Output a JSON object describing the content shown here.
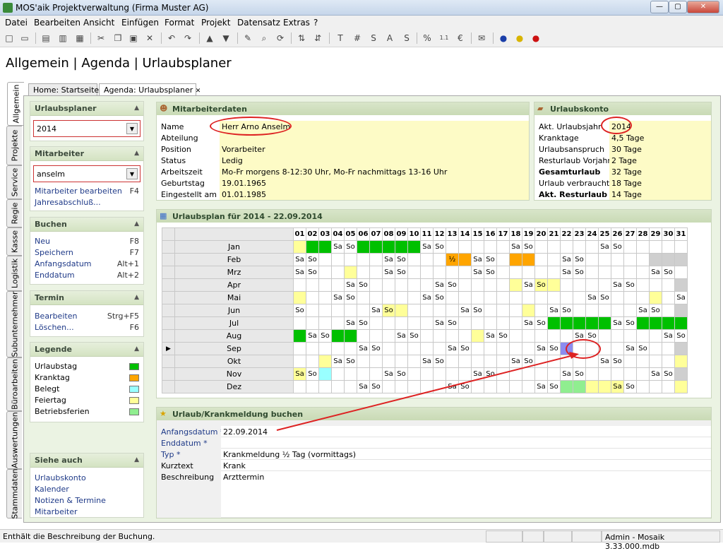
{
  "window": {
    "title": "MOS'aik Projektverwaltung (Firma Muster AG)",
    "minimize": "—",
    "maximize": "▢",
    "close": "✕"
  },
  "menu": [
    "Datei",
    "Bearbeiten",
    "Ansicht",
    "Einfügen",
    "Format",
    "Projekt",
    "Datensatz",
    "Extras",
    "?"
  ],
  "page_title": "Allgemein | Agenda | Urlaubsplaner",
  "vtabs": [
    "Allgemein",
    "Projekte",
    "Service",
    "Regie",
    "Kasse",
    "Logistik",
    "Subunternehmer",
    "Büroarbeiten",
    "Auswertungen",
    "Stammdaten"
  ],
  "doc_tabs": [
    "Home: Startseite",
    "Agenda: Urlaubsplaner"
  ],
  "sidebar": {
    "urlaubsplaner": {
      "title": "Urlaubsplaner",
      "value": "2014"
    },
    "mitarbeiter": {
      "title": "Mitarbeiter",
      "value": "anselm",
      "items": [
        {
          "label": "Mitarbeiter bearbeiten",
          "key": "F4"
        },
        {
          "label": "Jahresabschluß...",
          "key": ""
        }
      ]
    },
    "buchen": {
      "title": "Buchen",
      "items": [
        {
          "label": "Neu",
          "key": "F8"
        },
        {
          "label": "Speichern",
          "key": "F7"
        },
        {
          "label": "Anfangsdatum",
          "key": "Alt+1"
        },
        {
          "label": "Enddatum",
          "key": "Alt+2"
        }
      ]
    },
    "termin": {
      "title": "Termin",
      "items": [
        {
          "label": "Bearbeiten",
          "key": "Strg+F5"
        },
        {
          "label": "Löschen...",
          "key": "F6"
        }
      ]
    },
    "legende": {
      "title": "Legende",
      "items": [
        {
          "label": "Urlaubstag",
          "color": "#00c000"
        },
        {
          "label": "Kranktag",
          "color": "#ffa500"
        },
        {
          "label": "Belegt",
          "color": "#99ffff"
        },
        {
          "label": "Feiertag",
          "color": "#ffff99"
        },
        {
          "label": "Betriebsferien",
          "color": "#90ee90"
        }
      ]
    },
    "siehe_auch": {
      "title": "Siehe auch",
      "items": [
        "Urlaubskonto",
        "Kalender",
        "Notizen & Termine",
        "Mitarbeiter"
      ]
    }
  },
  "mitarbeiterdaten": {
    "title": "Mitarbeiterdaten",
    "rows": [
      {
        "label": "Name",
        "value": "Herr Arno Anselm"
      },
      {
        "label": "Abteilung",
        "value": ""
      },
      {
        "label": "Position",
        "value": "Vorarbeiter"
      },
      {
        "label": "Status",
        "value": "Ledig"
      },
      {
        "label": "Arbeitszeit",
        "value": "Mo-Fr morgens 8-12:30 Uhr, Mo-Fr nachmittags 13-16 Uhr"
      },
      {
        "label": "Geburtstag",
        "value": "19.01.1965"
      },
      {
        "label": "Eingestellt am",
        "value": "01.01.1985"
      }
    ]
  },
  "urlaubskonto": {
    "title": "Urlaubskonto",
    "rows": [
      {
        "label": "Akt. Urlaubsjahr",
        "value": "2014",
        "bold": false
      },
      {
        "label": "Kranktage",
        "value": "4,5 Tage",
        "bold": false
      },
      {
        "label": "Urlaubsanspruch",
        "value": "30 Tage",
        "bold": false
      },
      {
        "label": "Resturlaub Vorjahr",
        "value": "2 Tage",
        "bold": false
      },
      {
        "label": "Gesamturlaub",
        "value": "32 Tage",
        "bold": true
      },
      {
        "label": "Urlaub verbraucht",
        "value": "18 Tage",
        "bold": false
      },
      {
        "label": "Akt. Resturlaub",
        "value": "14 Tage",
        "bold": true
      }
    ]
  },
  "urlaubsplan": {
    "title": "Urlaubsplan für 2014 - 22.09.2014",
    "days": [
      "01",
      "02",
      "03",
      "04",
      "05",
      "06",
      "07",
      "08",
      "09",
      "10",
      "11",
      "12",
      "13",
      "14",
      "15",
      "16",
      "17",
      "18",
      "19",
      "20",
      "21",
      "22",
      "23",
      "24",
      "25",
      "26",
      "27",
      "28",
      "29",
      "30",
      "31"
    ],
    "months": [
      {
        "name": "Jan",
        "cells": [
          "f:",
          "u:",
          "u:",
          "g:Sa",
          "g:So",
          "u:",
          "u:",
          "u:",
          "u:",
          "u:",
          "g:Sa",
          "g:So",
          "",
          "",
          "",
          "",
          "",
          "g:Sa",
          "g:So",
          "",
          "",
          "",
          "",
          "",
          "g:Sa",
          "g:So",
          "",
          "",
          "",
          "",
          ""
        ]
      },
      {
        "name": "Feb",
        "cells": [
          "g:Sa",
          "g:So",
          "",
          "",
          "",
          "",
          "",
          "g:Sa",
          "g:So",
          "",
          "",
          "",
          "k:½",
          "k:",
          "g:Sa",
          "g:So",
          "",
          "k:",
          "k:",
          "",
          "",
          "g:Sa",
          "g:So",
          "",
          "",
          "",
          "",
          "",
          "x:",
          "x:",
          "x:"
        ]
      },
      {
        "name": "Mrz",
        "cells": [
          "g:Sa",
          "g:So",
          "",
          "",
          "f:",
          "",
          "",
          "g:Sa",
          "g:So",
          "",
          "",
          "",
          "",
          "",
          "g:Sa",
          "g:So",
          "",
          "",
          "",
          "",
          "",
          "g:Sa",
          "g:So",
          "",
          "",
          "",
          "",
          "",
          "g:Sa",
          "g:So",
          ""
        ]
      },
      {
        "name": "Apr",
        "cells": [
          "",
          "",
          "",
          "",
          "g:Sa",
          "g:So",
          "",
          "",
          "",
          "",
          "",
          "g:Sa",
          "g:So",
          "",
          "",
          "",
          "",
          "f:",
          "g:Sa",
          "f:So",
          "f:",
          "",
          "",
          "",
          "",
          "g:Sa",
          "g:So",
          "",
          "",
          "",
          "x:"
        ]
      },
      {
        "name": "Mai",
        "cells": [
          "f:",
          "",
          "",
          "g:Sa",
          "g:So",
          "",
          "",
          "",
          "",
          "",
          "g:Sa",
          "g:So",
          "",
          "",
          "",
          "",
          "",
          "",
          "",
          "",
          "",
          "",
          "",
          "g:Sa",
          "g:So",
          "",
          "",
          "",
          "f:",
          "",
          "g:Sa"
        ]
      },
      {
        "name": "Jun",
        "cells": [
          "g:So",
          "",
          "",
          "",
          "",
          "",
          "g:Sa",
          "f:So",
          "f:",
          "",
          "",
          "",
          "",
          "g:Sa",
          "g:So",
          "",
          "",
          "",
          "f:",
          "",
          "g:Sa",
          "g:So",
          "",
          "",
          "",
          "",
          "",
          "g:Sa",
          "g:So",
          "",
          "x:"
        ]
      },
      {
        "name": "Jul",
        "cells": [
          "",
          "",
          "",
          "",
          "g:Sa",
          "g:So",
          "",
          "",
          "",
          "",
          "",
          "g:Sa",
          "g:So",
          "",
          "",
          "",
          "",
          "",
          "g:Sa",
          "g:So",
          "u:",
          "u:",
          "u:",
          "u:",
          "u:",
          "g:Sa",
          "g:So",
          "u:",
          "u:",
          "u:",
          "u:"
        ]
      },
      {
        "name": "Aug",
        "cells": [
          "u:",
          "g:Sa",
          "g:So",
          "u:",
          "u:",
          "",
          "",
          "",
          "g:Sa",
          "g:So",
          "",
          "",
          "",
          "",
          "f:",
          "g:Sa",
          "g:So",
          "",
          "",
          "",
          "",
          "",
          "g:Sa",
          "g:So",
          "",
          "",
          "",
          "",
          "",
          "g:Sa",
          "g:So"
        ]
      },
      {
        "name": "Sep",
        "cells": [
          "",
          "",
          "",
          "",
          "",
          "g:Sa",
          "g:So",
          "",
          "",
          "",
          "",
          "",
          "g:Sa",
          "g:So",
          "",
          "",
          "",
          "",
          "",
          "g:Sa",
          "g:So",
          "b:",
          "",
          "",
          "",
          "",
          "g:Sa",
          "g:So",
          "",
          "",
          "x:"
        ]
      },
      {
        "name": "Okt",
        "cells": [
          "",
          "",
          "f:",
          "g:Sa",
          "g:So",
          "",
          "",
          "",
          "",
          "",
          "g:Sa",
          "g:So",
          "",
          "",
          "",
          "",
          "",
          "g:Sa",
          "g:So",
          "",
          "",
          "",
          "",
          "",
          "g:Sa",
          "g:So",
          "",
          "",
          "",
          "",
          "f:"
        ]
      },
      {
        "name": "Nov",
        "cells": [
          "f:Sa",
          "g:So",
          "c:",
          "",
          "",
          "",
          "",
          "g:Sa",
          "g:So",
          "",
          "",
          "",
          "",
          "",
          "g:Sa",
          "g:So",
          "",
          "",
          "",
          "",
          "",
          "g:Sa",
          "g:So",
          "",
          "",
          "",
          "",
          "",
          "g:Sa",
          "g:So",
          "x:"
        ]
      },
      {
        "name": "Dez",
        "cells": [
          "",
          "",
          "",
          "",
          "",
          "g:Sa",
          "g:So",
          "",
          "",
          "",
          "",
          "",
          "g:Sa",
          "g:So",
          "",
          "",
          "",
          "",
          "",
          "g:Sa",
          "g:So",
          "l:",
          "l:",
          "f:",
          "f:",
          "f:Sa",
          "g:So",
          "",
          "",
          "",
          "f:"
        ]
      }
    ]
  },
  "buchung": {
    "title": "Urlaub/Krankmeldung buchen",
    "rows": [
      {
        "label": "Anfangsdatum *",
        "value": "22.09.2014",
        "req": true
      },
      {
        "label": "Enddatum *",
        "value": "",
        "req": true
      },
      {
        "label": "Typ *",
        "value": "Krankmeldung ½ Tag (vormittags)",
        "req": true
      },
      {
        "label": "Kurztext",
        "value": "Krank",
        "req": false
      },
      {
        "label": "Beschreibung",
        "value": "Arzttermin",
        "req": false
      }
    ]
  },
  "statusbar": {
    "text": "Enthält die Beschreibung der Buchung.",
    "right": "Admin - Mosaik 3.33.000.mdb"
  }
}
